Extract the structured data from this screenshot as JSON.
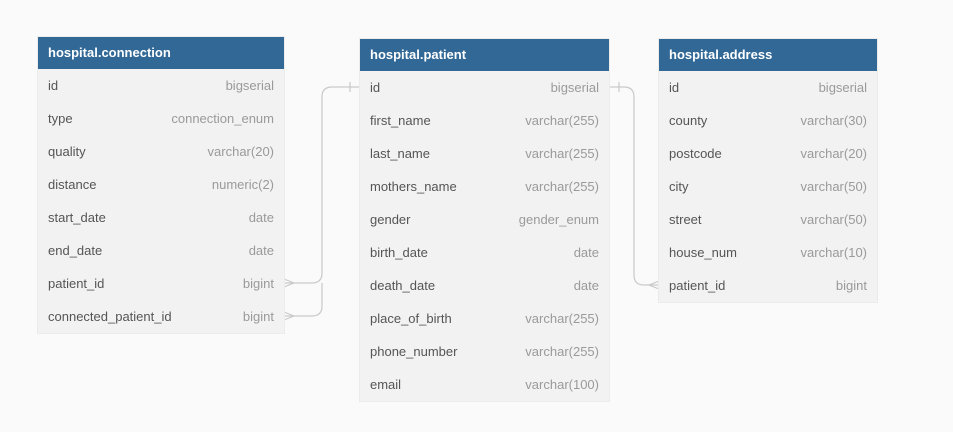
{
  "tables": [
    {
      "name": "hospital.connection",
      "columns": [
        {
          "name": "id",
          "type": "bigserial"
        },
        {
          "name": "type",
          "type": "connection_enum"
        },
        {
          "name": "quality",
          "type": "varchar(20)"
        },
        {
          "name": "distance",
          "type": "numeric(2)"
        },
        {
          "name": "start_date",
          "type": "date"
        },
        {
          "name": "end_date",
          "type": "date"
        },
        {
          "name": "patient_id",
          "type": "bigint"
        },
        {
          "name": "connected_patient_id",
          "type": "bigint"
        }
      ]
    },
    {
      "name": "hospital.patient",
      "columns": [
        {
          "name": "id",
          "type": "bigserial"
        },
        {
          "name": "first_name",
          "type": "varchar(255)"
        },
        {
          "name": "last_name",
          "type": "varchar(255)"
        },
        {
          "name": "mothers_name",
          "type": "varchar(255)"
        },
        {
          "name": "gender",
          "type": "gender_enum"
        },
        {
          "name": "birth_date",
          "type": "date"
        },
        {
          "name": "death_date",
          "type": "date"
        },
        {
          "name": "place_of_birth",
          "type": "varchar(255)"
        },
        {
          "name": "phone_number",
          "type": "varchar(255)"
        },
        {
          "name": "email",
          "type": "varchar(100)"
        }
      ]
    },
    {
      "name": "hospital.address",
      "columns": [
        {
          "name": "id",
          "type": "bigserial"
        },
        {
          "name": "county",
          "type": "varchar(30)"
        },
        {
          "name": "postcode",
          "type": "varchar(20)"
        },
        {
          "name": "city",
          "type": "varchar(50)"
        },
        {
          "name": "street",
          "type": "varchar(50)"
        },
        {
          "name": "house_num",
          "type": "varchar(10)"
        },
        {
          "name": "patient_id",
          "type": "bigint"
        }
      ]
    }
  ],
  "relationships": [
    {
      "from": "hospital.connection.patient_id",
      "to": "hospital.patient.id",
      "cardinality": "many-to-one"
    },
    {
      "from": "hospital.connection.connected_patient_id",
      "to": "hospital.patient.id",
      "cardinality": "many-to-one"
    },
    {
      "from": "hospital.address.patient_id",
      "to": "hospital.patient.id",
      "cardinality": "many-to-one"
    }
  ]
}
